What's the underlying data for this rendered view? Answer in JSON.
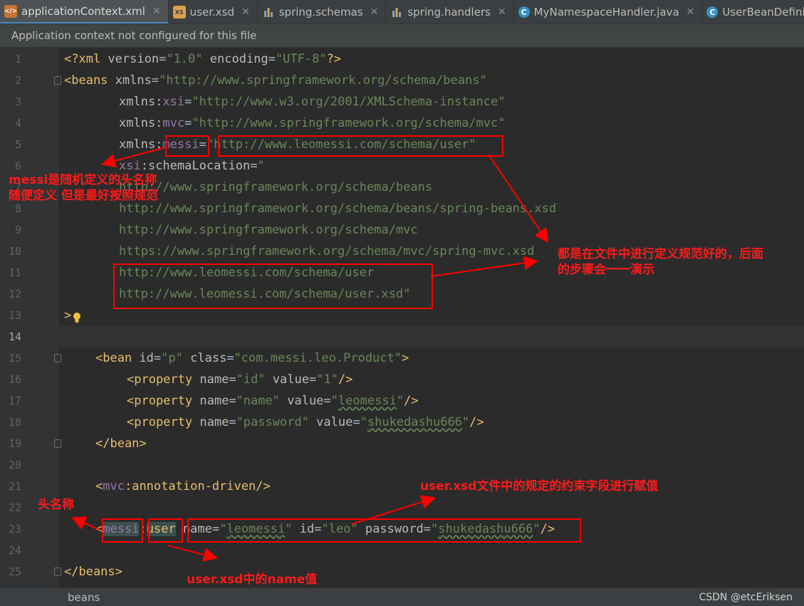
{
  "tabs": [
    {
      "label": "applicationContext.xml",
      "icon": "xml-file-icon",
      "active": true
    },
    {
      "label": "user.xsd",
      "icon": "xsd-file-icon"
    },
    {
      "label": "spring.schemas",
      "icon": "properties-file-icon"
    },
    {
      "label": "spring.handlers",
      "icon": "properties-file-icon"
    },
    {
      "label": "MyNamespaceHandler.java",
      "icon": "java-class-icon"
    },
    {
      "label": "UserBeanDefiniti",
      "icon": "java-class-icon"
    }
  ],
  "banner": {
    "text": "Application context not configured for this file"
  },
  "editor": {
    "line_numbers": [
      "1",
      "2",
      "3",
      "4",
      "5",
      "6",
      "7",
      "8",
      "9",
      "10",
      "11",
      "12",
      "13",
      "14",
      "15",
      "16",
      "17",
      "18",
      "19",
      "20",
      "21",
      "22",
      "23",
      "24",
      "25"
    ],
    "current_line": "14"
  },
  "code": {
    "l1": {
      "open": "<?xml ",
      "a1": "version",
      "eq1": "=",
      "v1": "\"1.0\"",
      "sp": " ",
      "a2": "encoding",
      "eq2": "=",
      "v2": "\"UTF-8\"",
      "close": "?>"
    },
    "l2": {
      "tag": "<beans",
      "attr": "xmlns",
      "eq": "=",
      "val": "\"http://www.springframework.org/schema/beans\""
    },
    "l3": {
      "attr": "xmlns:",
      "ns": "xsi",
      "eq": "=",
      "val": "\"http://www.w3.org/2001/XMLSchema-instance\""
    },
    "l4": {
      "attr": "xmlns:",
      "ns": "mvc",
      "eq": "=",
      "val": "\"http://www.springframework.org/schema/mvc\""
    },
    "l5": {
      "attr": "xmlns:",
      "ns": "messi",
      "eq": "=",
      "val": "\"http://www.leomessi.com/schema/user\""
    },
    "l6": {
      "ns": "xsi",
      "attr": ":schemaLocation",
      "eq": "=",
      "val": "\""
    },
    "l7": "http://www.springframework.org/schema/beans",
    "l8": "http://www.springframework.org/schema/beans/spring-beans.xsd",
    "l9": "http://www.springframework.org/schema/mvc",
    "l10": "https://www.springframework.org/schema/mvc/spring-mvc.xsd",
    "l11": "http://www.leomessi.com/schema/user",
    "l12": "http://www.leomessi.com/schema/user.xsd\"",
    "l13": ">",
    "l15": {
      "tag": "<bean ",
      "a1": "id",
      "eq1": "=",
      "v1": "\"p\"",
      "a2": "class",
      "eq2": "=",
      "v2": "\"com.messi.leo.Product\"",
      "close": ">"
    },
    "l16": {
      "tag": "<property ",
      "a1": "name",
      "eq1": "=",
      "v1": "\"id\"",
      "a2": "value",
      "eq2": "=",
      "v2": "\"1\"",
      "close": "/>"
    },
    "l17": {
      "tag": "<property ",
      "a1": "name",
      "eq1": "=",
      "v1": "\"name\"",
      "a2": "value",
      "eq2": "=",
      "vq": "\"",
      "v2": "leomessi",
      "vq2": "\"",
      "close": "/>"
    },
    "l18": {
      "tag": "<property ",
      "a1": "name",
      "eq1": "=",
      "v1": "\"password\"",
      "a2": "value",
      "eq2": "=",
      "vq": "\"",
      "v2": "shukedashu666",
      "vq2": "\"",
      "close": "/>"
    },
    "l19": "</bean>",
    "l21": {
      "lt": "<",
      "ns": "mvc",
      "rest": ":annotation-driven/>"
    },
    "l23": {
      "lt": "<",
      "ns": "messi",
      "colon": ":",
      "tag": "user",
      "sp": " ",
      "a1": "name",
      "eq1": "=",
      "q1": "\"",
      "v1": "leomessi",
      "q1b": "\"",
      "a2": "id",
      "eq2": "=",
      "v2": "\"leo\"",
      "a3": "password",
      "eq3": "=",
      "q3": "\"",
      "v3": "shukedashu666",
      "q3b": "\"",
      "close": "/>"
    },
    "l25": "</beans>"
  },
  "annotations": {
    "n1_line1": "messi是随机定义的头名称",
    "n1_line2": "随便定义 但是最好按照规范",
    "n2_line1": "都是在文件中进行定义规范好的，后面",
    "n2_line2": "的步骤会一一演示",
    "n3": "头名称",
    "n4": "user.xsd文件中的规定的约束字段进行赋值",
    "n5": "user.xsd中的name值"
  },
  "status": {
    "breadcrumb": "beans",
    "watermark": "CSDN @etcEriksen"
  },
  "colors": {
    "annotation": "#ff0000",
    "tag": "#e8bf6a",
    "value": "#6a8759",
    "namespace": "#9876aa"
  }
}
